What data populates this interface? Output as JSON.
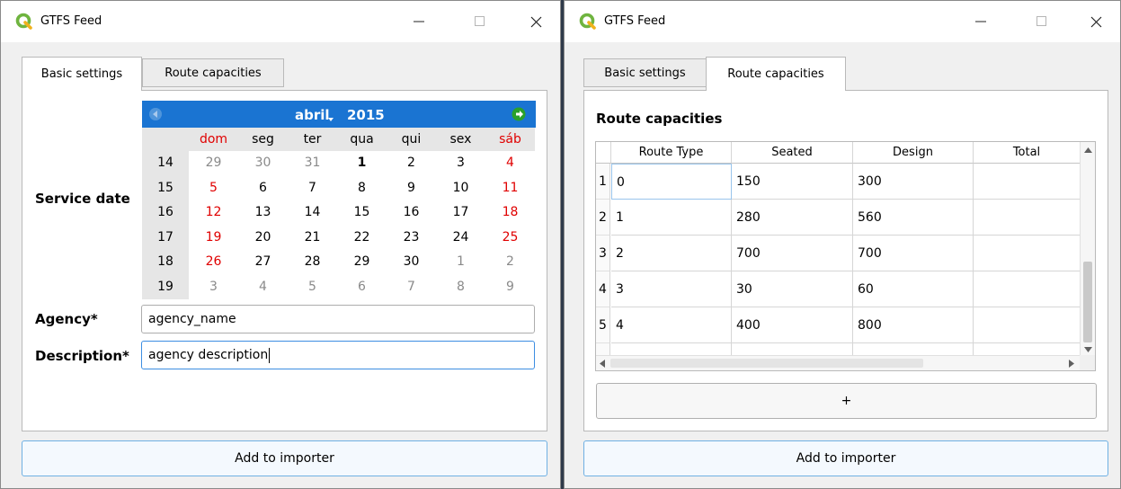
{
  "left_window": {
    "title": "GTFS Feed",
    "tabs": [
      "Basic settings",
      "Route capacities"
    ],
    "service_date_label": "Service date",
    "calendar": {
      "month": "abril",
      "year": "2015",
      "day_names": [
        "dom",
        "seg",
        "ter",
        "qua",
        "qui",
        "sex",
        "sáb"
      ],
      "weeks": [
        {
          "wk": "14",
          "days": [
            "29",
            "30",
            "31",
            "1",
            "2",
            "3",
            "4"
          ]
        },
        {
          "wk": "15",
          "days": [
            "5",
            "6",
            "7",
            "8",
            "9",
            "10",
            "11"
          ]
        },
        {
          "wk": "16",
          "days": [
            "12",
            "13",
            "14",
            "15",
            "16",
            "17",
            "18"
          ]
        },
        {
          "wk": "17",
          "days": [
            "19",
            "20",
            "21",
            "22",
            "23",
            "24",
            "25"
          ]
        },
        {
          "wk": "18",
          "days": [
            "26",
            "27",
            "28",
            "29",
            "30",
            "1",
            "2"
          ]
        },
        {
          "wk": "19",
          "days": [
            "3",
            "4",
            "5",
            "6",
            "7",
            "8",
            "9"
          ]
        }
      ],
      "selected_day": "1",
      "colors": {
        "header": "#1a74d2",
        "weekend": "#e00000",
        "other_month": "#8a8a8a"
      }
    },
    "agency_label": "Agency*",
    "agency_value": "agency_name",
    "description_label": "Description*",
    "description_value": "agency description",
    "add_button": "Add to importer"
  },
  "right_window": {
    "title": "GTFS Feed",
    "tabs": [
      "Basic settings",
      "Route capacities"
    ],
    "section_title": "Route capacities",
    "table": {
      "columns": [
        "Route Type",
        "Seated",
        "Design",
        "Total"
      ],
      "rows": [
        {
          "num": "1",
          "cells": [
            "0",
            "150",
            "300",
            ""
          ]
        },
        {
          "num": "2",
          "cells": [
            "1",
            "280",
            "560",
            ""
          ]
        },
        {
          "num": "3",
          "cells": [
            "2",
            "700",
            "700",
            ""
          ]
        },
        {
          "num": "4",
          "cells": [
            "3",
            "30",
            "60",
            ""
          ]
        },
        {
          "num": "5",
          "cells": [
            "4",
            "400",
            "800",
            ""
          ]
        }
      ]
    },
    "plus_button": "+",
    "add_button": "Add to importer"
  }
}
